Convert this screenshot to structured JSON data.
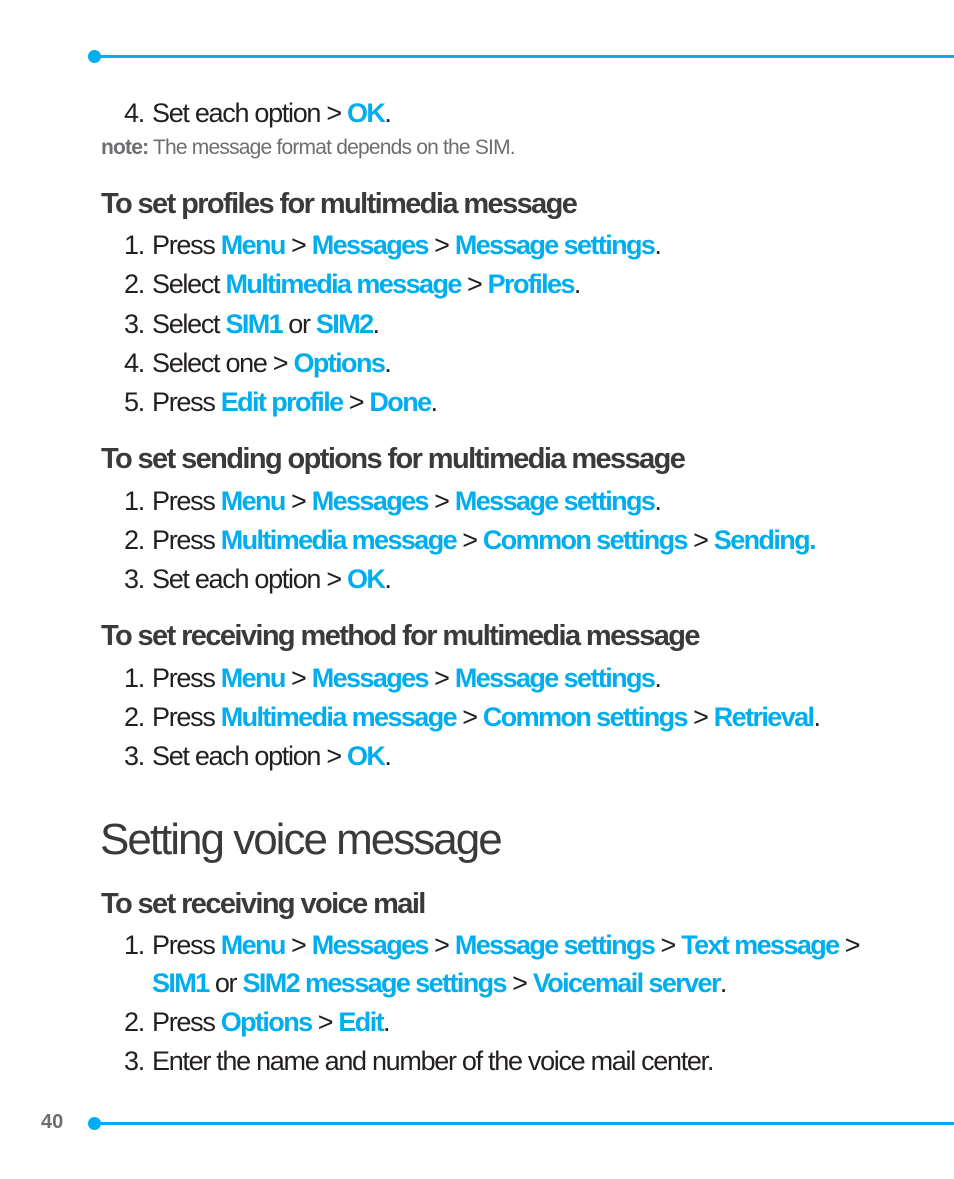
{
  "header": {
    "rule_color": "#00aeef"
  },
  "top_continuation": {
    "step": {
      "num": "4.",
      "pre": "Set each option > ",
      "hl": "OK",
      "post": "."
    }
  },
  "note": {
    "label": "note:",
    "text": " The message format depends on the SIM."
  },
  "sections": [
    {
      "heading": "To set profiles for multimedia message",
      "steps": [
        {
          "num": "1.",
          "parts": [
            "Press ",
            "Menu",
            " > ",
            "Messages",
            " > ",
            "Message settings",
            "."
          ]
        },
        {
          "num": "2.",
          "parts": [
            "Select ",
            "Multimedia message",
            " > ",
            "Profiles",
            "."
          ]
        },
        {
          "num": "3.",
          "parts": [
            "Select ",
            "SIM1",
            " or ",
            "SIM2",
            "."
          ]
        },
        {
          "num": "4.",
          "parts": [
            "Select one > ",
            "Options",
            "."
          ]
        },
        {
          "num": "5.",
          "parts": [
            "Press ",
            "Edit profile",
            " > ",
            "Done",
            "."
          ]
        }
      ]
    },
    {
      "heading": "To set sending options for multimedia message",
      "steps": [
        {
          "num": "1.",
          "parts": [
            "Press ",
            "Menu",
            " > ",
            "Messages",
            " > ",
            "Message settings",
            "."
          ]
        },
        {
          "num": "2.",
          "parts": [
            "Press ",
            "Multimedia message",
            " > ",
            "Common settings",
            " > ",
            "Sending."
          ]
        },
        {
          "num": "3.",
          "parts": [
            "Set each option > ",
            "OK",
            "."
          ]
        }
      ]
    },
    {
      "heading": "To set receiving method for multimedia message",
      "steps": [
        {
          "num": "1.",
          "parts": [
            "Press ",
            "Menu",
            " > ",
            "Messages",
            " > ",
            "Message settings",
            "."
          ]
        },
        {
          "num": "2.",
          "parts": [
            "Press ",
            "Multimedia message",
            " > ",
            "Common settings",
            " > ",
            "Retrieval",
            "."
          ]
        },
        {
          "num": "3.",
          "parts": [
            "Set each option > ",
            "OK",
            "."
          ]
        }
      ]
    }
  ],
  "chapter": {
    "title": "Setting voice message",
    "subsection": {
      "heading": "To set receiving voice mail",
      "step1_line1": {
        "num": "1.",
        "parts": [
          "Press ",
          "Menu",
          " > ",
          "Messages",
          " > ",
          "Message settings",
          " > ",
          "Text message",
          " >"
        ]
      },
      "step1_line2": {
        "parts": [
          "SIM1",
          " or ",
          "SIM2 message settings",
          " > ",
          "Voicemail server",
          "."
        ]
      },
      "step2": {
        "num": "2.",
        "parts": [
          "Press ",
          "Options",
          " > ",
          "Edit",
          "."
        ]
      },
      "step3": {
        "num": "3.",
        "text": "Enter the name and number of the voice mail center."
      }
    }
  },
  "footer": {
    "page_number": "40"
  }
}
